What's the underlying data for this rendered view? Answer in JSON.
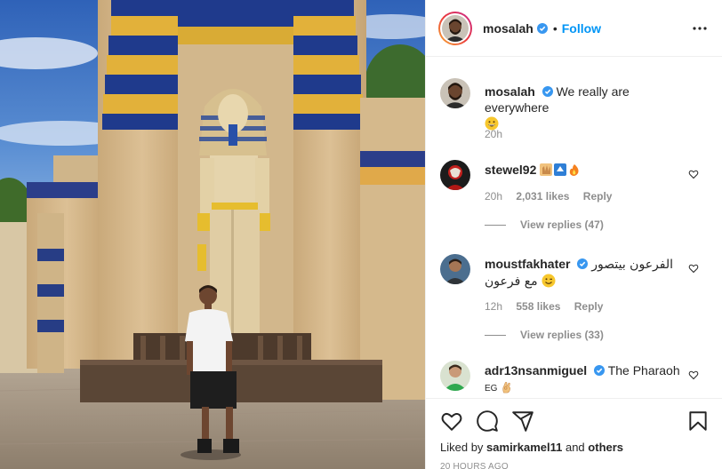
{
  "post": {
    "author": "mosalah",
    "follow_label": "Follow",
    "dot": "•",
    "caption": "We really are everywhere",
    "caption_time": "20h"
  },
  "comments": [
    {
      "user": "stewel92",
      "time": "20h",
      "likes": "2,031 likes",
      "reply": "Reply",
      "view_replies": "View replies (47)"
    },
    {
      "user": "moustfakhater",
      "text": "الفرعون بيتصور مع فرعون",
      "time": "12h",
      "likes": "558 likes",
      "reply": "Reply",
      "view_replies": "View replies (33)"
    },
    {
      "user": "adr13nsanmiguel",
      "text": "The Pharaoh",
      "text2": "EG"
    }
  ],
  "footer": {
    "liked_by_prefix": "Liked by",
    "liked_by_user": "samirkamel11",
    "liked_by_and": "and",
    "liked_by_others": "others",
    "time_ago": "20 HOURS AGO"
  },
  "icons": [
    "more-options-icon",
    "verified-icon",
    "heart-icon",
    "comment-icon",
    "share-icon",
    "bookmark-icon"
  ],
  "colors": {
    "accent": "#0095f6",
    "verified": "#3897f0",
    "muted": "#8e8e8e"
  }
}
